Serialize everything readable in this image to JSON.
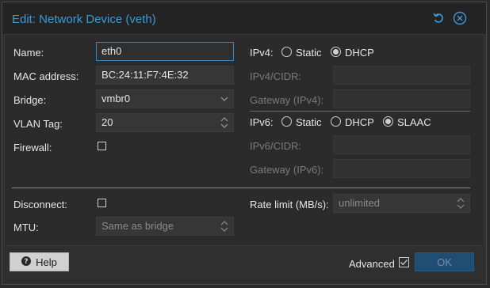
{
  "dialog": {
    "title": "Edit: Network Device (veth)"
  },
  "left": {
    "name_label": "Name:",
    "name_value": "eth0",
    "mac_label": "MAC address:",
    "mac_value": "BC:24:11:F7:4E:32",
    "bridge_label": "Bridge:",
    "bridge_value": "vmbr0",
    "vlan_label": "VLAN Tag:",
    "vlan_value": "20",
    "firewall_label": "Firewall:",
    "firewall_checked": false
  },
  "right": {
    "ipv4_label": "IPv4:",
    "ipv4_options": [
      {
        "label": "Static",
        "selected": false
      },
      {
        "label": "DHCP",
        "selected": true
      }
    ],
    "ipv4_cidr_label": "IPv4/CIDR:",
    "gateway4_label": "Gateway (IPv4):",
    "ipv6_label": "IPv6:",
    "ipv6_options": [
      {
        "label": "Static",
        "selected": false
      },
      {
        "label": "DHCP",
        "selected": false
      },
      {
        "label": "SLAAC",
        "selected": true
      }
    ],
    "ipv6_cidr_label": "IPv6/CIDR:",
    "gateway6_label": "Gateway (IPv6):"
  },
  "advanced_section": {
    "disconnect_label": "Disconnect:",
    "disconnect_checked": false,
    "mtu_label": "MTU:",
    "mtu_placeholder": "Same as bridge",
    "rate_label": "Rate limit (MB/s):",
    "rate_placeholder": "unlimited"
  },
  "footer": {
    "help_label": "Help",
    "advanced_label": "Advanced",
    "advanced_checked": true,
    "ok_label": "OK"
  },
  "colors": {
    "accent": "#3a9bd9",
    "ok_button": "#1f4d73",
    "background": "#2b2b2b"
  }
}
